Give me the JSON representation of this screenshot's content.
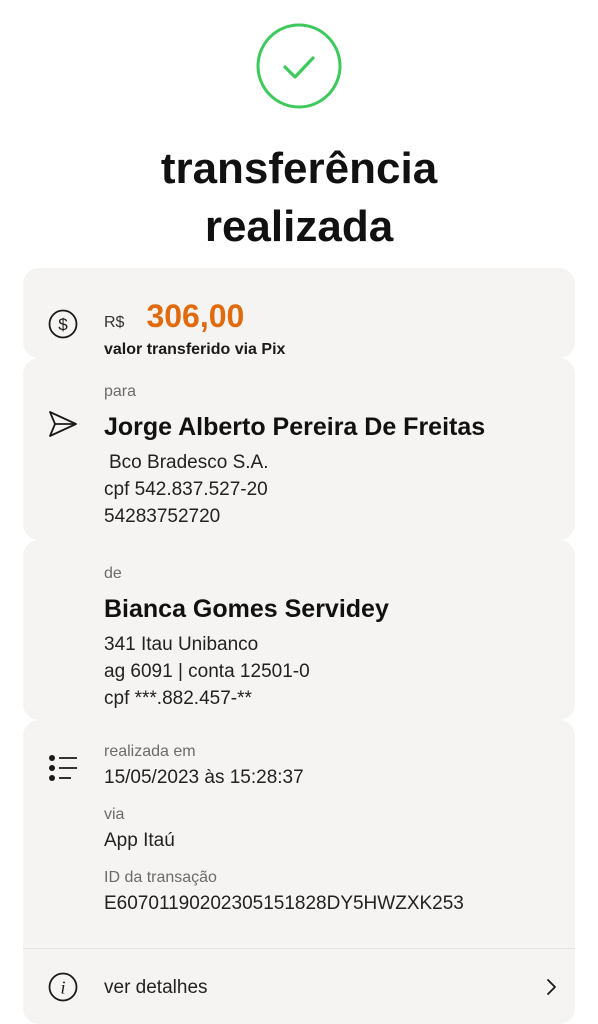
{
  "header": {
    "title_line1": "transferência",
    "title_line2": "realizada",
    "success_color": "#3ec95c",
    "success_icon": "check-circle-icon"
  },
  "amount": {
    "currency": "R$",
    "value": "306,00",
    "caption": "valor transferido via Pix",
    "accent_color": "#e06a0c",
    "icon": "dollar-circle-icon"
  },
  "recipient": {
    "label": "para",
    "name": "Jorge Alberto Pereira De Freitas",
    "bank": "Bco Bradesco S.A.",
    "cpf": "cpf 542.837.527-20",
    "key": "54283752720",
    "icon": "send-icon"
  },
  "sender": {
    "label": "de",
    "name": "Bianca Gomes Servidey",
    "bank": "341 Itau Unibanco",
    "account": "ag 6091 | conta 12501-0",
    "cpf": "cpf ***.882.457-**"
  },
  "info": {
    "icon": "list-icon",
    "date_label": "realizada em",
    "date_value": "15/05/2023 às 15:28:37",
    "via_label": "via",
    "via_value": "App Itaú",
    "id_label": "ID da transação",
    "id_value": "E60701190202305151828DY5HWZXK253"
  },
  "details": {
    "label": "ver detalhes",
    "icon": "info-icon",
    "chevron": "chevron-right-icon"
  }
}
